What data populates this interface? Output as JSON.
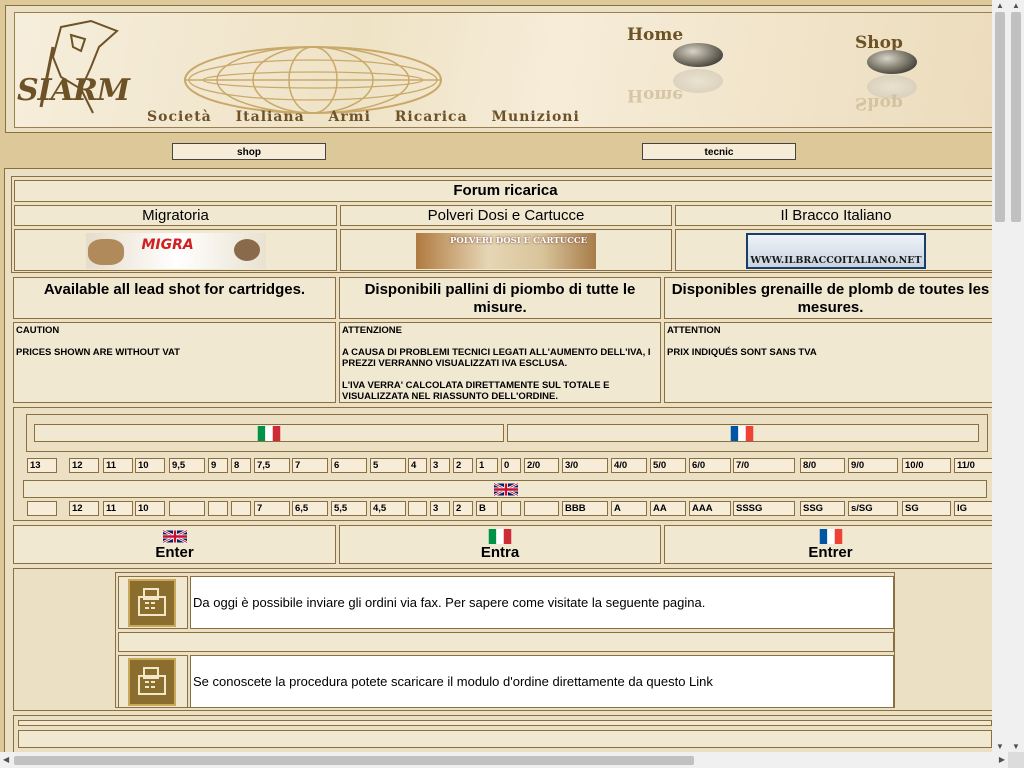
{
  "header": {
    "logo_text": "SIARM",
    "tagline": [
      "Società",
      "Italiana",
      "Armi",
      "Ricarica",
      "Munizioni"
    ],
    "nav": [
      {
        "label": "Home"
      },
      {
        "label": "Shop"
      }
    ]
  },
  "topbuttons": {
    "shop": "shop",
    "tecnic": "tecnic"
  },
  "forum": {
    "title": "Forum ricarica",
    "items": [
      {
        "name": "Migratoria",
        "banner": "MIGRA"
      },
      {
        "name": "Polveri Dosi e Cartucce",
        "banner": "POLVERI DOSI E CARTUCCE"
      },
      {
        "name": "Il Bracco Italiano",
        "banner": "WWW.ILBRACCOITALIANO.NET"
      }
    ]
  },
  "availability": [
    "Available all lead shot for cartridges.",
    "Disponibili pallini di piombo di tutte le misure.",
    "Disponibles grenaille de plomb de toutes les mesures."
  ],
  "notices": [
    {
      "title": "CAUTION",
      "lines": [
        "PRICES SHOWN ARE WITHOUT VAT"
      ]
    },
    {
      "title": "ATTENZIONE",
      "lines": [
        "A CAUSA DI PROBLEMI TECNICI LEGATI ALL'AUMENTO DELL'IVA, I PREZZI VERRANNO VISUALIZZATI IVA ESCLUSA.",
        "L'IVA VERRA' CALCOLATA DIRETTAMENTE SUL TOTALE E VISUALIZZATA NEL RIASSUNTO DELL'ORDINE."
      ]
    },
    {
      "title": "ATTENTION",
      "lines": [
        "PRIX INDIQUÉS SONT SANS TVA"
      ]
    }
  ],
  "sizes_italian_french": [
    "13",
    "12",
    "11",
    "10",
    "9,5",
    "9",
    "8",
    "7,5",
    "7",
    "6",
    "5",
    "4",
    "3",
    "2",
    "1",
    "0",
    "2/0",
    "3/0",
    "4/0",
    "5/0",
    "6/0",
    "7/0",
    "8/0",
    "9/0",
    "10/0",
    "11/0"
  ],
  "sizes_english": [
    "",
    "12",
    "11",
    "10",
    "",
    "",
    "",
    "7",
    "6,5",
    "5,5",
    "4,5",
    "",
    "3",
    "2",
    "B",
    "",
    "",
    "BBB",
    "A",
    "AA",
    "AAA",
    "SSSG",
    "SSG",
    "s/SG",
    "SG",
    "IG"
  ],
  "enter": [
    "Enter",
    "Entra",
    "Entrer"
  ],
  "fax": [
    "Da oggi è possibile inviare gli ordini via fax. Per sapere come visitate la seguente pagina.",
    "Se conoscete la procedura potete scaricare il modulo d'ordine direttamente da questo Link"
  ],
  "colors": {
    "bg": "#dcc899",
    "panel": "#f1e8d2",
    "border": "#8a7040",
    "accent": "#6d5228"
  }
}
